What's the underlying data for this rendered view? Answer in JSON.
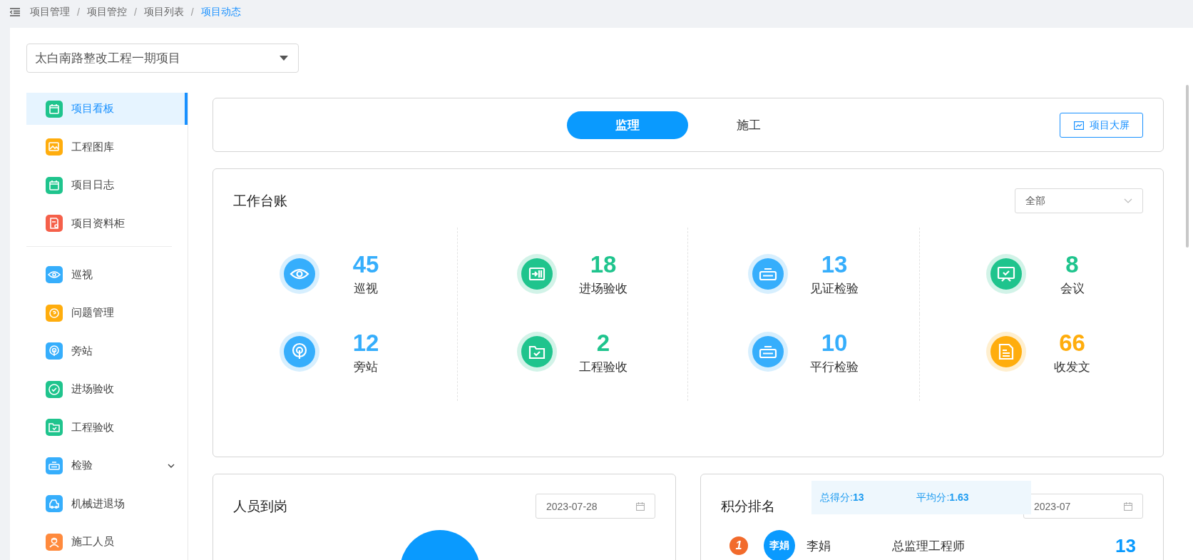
{
  "breadcrumb": [
    {
      "label": "项目管理",
      "selected": false
    },
    {
      "separator": "/",
      "label": "项目管控",
      "selected": false
    },
    {
      "separator": "/",
      "label": "项目列表",
      "selected": false
    },
    {
      "separator": "/",
      "label": "项目动态",
      "selected": true
    }
  ],
  "project_select": {
    "value": "太白南路整改工程一期项目"
  },
  "sidebar": {
    "groups": [
      [
        {
          "label": "项目看板",
          "kind": "board",
          "color": "#1fc48d",
          "selected": true
        },
        {
          "label": "工程图库",
          "kind": "image",
          "color": "#ffad0d",
          "selected": false
        },
        {
          "label": "项目日志",
          "kind": "log",
          "color": "#1fc48d",
          "selected": false
        },
        {
          "label": "项目资料柜",
          "kind": "file",
          "color": "#f5604a",
          "selected": false
        }
      ],
      [
        {
          "label": "巡视",
          "kind": "eye",
          "color": "#36aefc",
          "selected": false
        },
        {
          "label": "问题管理",
          "kind": "question",
          "color": "#ffad0d",
          "selected": false
        },
        {
          "label": "旁站",
          "kind": "radar",
          "color": "#36aefc",
          "selected": false
        },
        {
          "label": "进场验收",
          "kind": "check",
          "color": "#1fc48d",
          "selected": false
        },
        {
          "label": "工程验收",
          "kind": "folder",
          "color": "#1fc48d",
          "selected": false
        },
        {
          "label": "检验",
          "kind": "meter",
          "color": "#36aefc",
          "selected": false,
          "expanded": false
        },
        {
          "label": "机械进退场",
          "kind": "machine",
          "color": "#36aefc",
          "selected": false
        },
        {
          "label": "施工人员",
          "kind": "worker",
          "color": "#ff8a3d",
          "selected": false
        }
      ]
    ]
  },
  "mode_tabs": [
    {
      "label": "监理",
      "selected": true
    },
    {
      "label": "施工",
      "selected": false
    }
  ],
  "screen_button": {
    "label": "项目大屏"
  },
  "ledger": {
    "title": "工作台账",
    "filter": {
      "value": "全部"
    },
    "items": [
      {
        "value": "45",
        "label": "巡视",
        "kind": "eye",
        "color": "#36aefc"
      },
      {
        "value": "18",
        "label": "进场验收",
        "kind": "enter",
        "color": "#1fc48d"
      },
      {
        "value": "13",
        "label": "见证检验",
        "kind": "meter",
        "color": "#36aefc"
      },
      {
        "value": "8",
        "label": "会议",
        "kind": "meeting",
        "color": "#1fc48d"
      },
      {
        "value": "12",
        "label": "旁站",
        "kind": "radar",
        "color": "#36aefc"
      },
      {
        "value": "2",
        "label": "工程验收",
        "kind": "folder",
        "color": "#1fc48d"
      },
      {
        "value": "10",
        "label": "平行检验",
        "kind": "meter",
        "color": "#36aefc"
      },
      {
        "value": "66",
        "label": "收发文",
        "kind": "doc",
        "color": "#ffad0d"
      }
    ]
  },
  "attendance": {
    "title": "人员到岗",
    "date": "2023-07-28"
  },
  "ranking": {
    "title": "积分排名",
    "total": "总得分:**13**",
    "average": "平均分:**1.63**",
    "date": "2023-07",
    "rows": [
      {
        "rank": "1",
        "avatar": "李娟",
        "name": "李娟",
        "role": "总监理工程师",
        "score": "13"
      }
    ]
  }
}
